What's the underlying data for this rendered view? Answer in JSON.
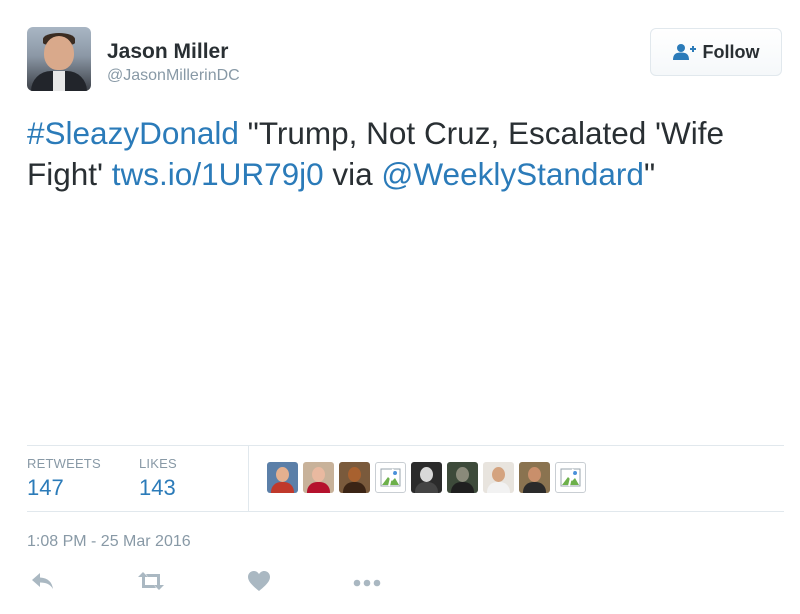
{
  "user": {
    "name": "Jason Miller",
    "handle": "@JasonMillerinDC"
  },
  "follow_button": {
    "label": "Follow"
  },
  "tweet": {
    "hashtag": "#SleazyDonald",
    "text_part1": " \"Trump, Not Cruz, Escalated 'Wife Fight' ",
    "link": "tws.io/1UR79j0",
    "text_part2": " via ",
    "mention": "@WeeklyStandard",
    "text_part3": "\""
  },
  "stats": {
    "retweets_label": "RETWEETS",
    "retweets_value": "147",
    "likes_label": "LIKES",
    "likes_value": "143"
  },
  "liker_avatars": [
    {
      "kind": "photo",
      "bg": "#5b7fa8",
      "head": "#e4b08f",
      "body": "#c0392b"
    },
    {
      "kind": "photo",
      "bg": "#c8b29a",
      "head": "#e9b9a0",
      "body": "#b5122d"
    },
    {
      "kind": "photo",
      "bg": "#7a5a3c",
      "head": "#a8612f",
      "body": "#3b2415"
    },
    {
      "kind": "broken"
    },
    {
      "kind": "photo",
      "bg": "#2b2b2b",
      "head": "#d8d8d8",
      "body": "#444444"
    },
    {
      "kind": "photo",
      "bg": "#3d4a3a",
      "head": "#8a8a7a",
      "body": "#1f1f1f"
    },
    {
      "kind": "photo",
      "bg": "#e8e4de",
      "head": "#d4a37f",
      "body": "#f2f2f2"
    },
    {
      "kind": "photo",
      "bg": "#8a7350",
      "head": "#c98f6b",
      "body": "#2a2a2a"
    },
    {
      "kind": "broken"
    }
  ],
  "timestamp": "1:08 PM - 25 Mar 2016",
  "actions": {
    "reply_icon": "reply-icon",
    "retweet_icon": "retweet-icon",
    "like_icon": "heart-icon",
    "more_icon": "more-icon"
  },
  "colors": {
    "link": "#2b7bb9",
    "muted": "#8899a6",
    "text": "#292f33",
    "icon": "#aab8c2"
  }
}
